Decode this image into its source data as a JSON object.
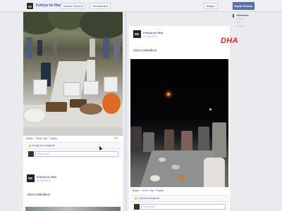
{
  "topbar": {
    "page_name": "Fethiye'de İftar",
    "dropdowns": [
      "Zaman Tüneli",
      "Yakınlarda"
    ],
    "like_button": "Beğen",
    "home_button": "Sayfa Olustur"
  },
  "sidebar": {
    "items": [
      "Yakınlarda",
      "Güncel",
      "2013",
      "Kurulus"
    ]
  },
  "left_post": {
    "actions": [
      "Beğen",
      "Yorum Yap",
      "Paylaş"
    ],
    "share_count": "1",
    "likes_text": "10 kişi bunu beğendi",
    "comment_placeholder": "Yorum yaz..."
  },
  "card2": {
    "page_name": "Fethiye'de İftar",
    "date": "11 Eylül 2013",
    "text": "Alarca Mahallesi"
  },
  "right_post": {
    "page_name": "Fethiye'de İftar",
    "date": "11 Eylül 2013",
    "text": "Alarca Mahallesi",
    "actions": [
      "Beğen",
      "Yorum Yap",
      "Paylaş"
    ],
    "likes_text": "4 kişi bunu beğendi",
    "comment_placeholder": "Yorum yaz..."
  },
  "watermark": {
    "logo": "DHA",
    "color": "#e2231a"
  },
  "colors": {
    "link": "#3b5998",
    "home_button": "#5b74a8",
    "background": "#e9ebee"
  }
}
